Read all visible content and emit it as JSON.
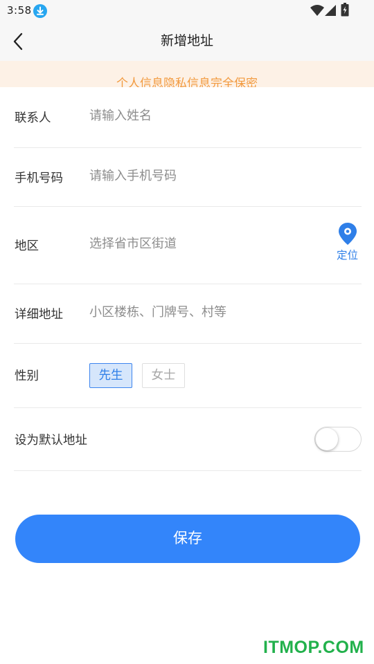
{
  "status_bar": {
    "time": "3:58",
    "icons": [
      "download-icon",
      "wifi-icon",
      "signal-icon",
      "battery-icon"
    ]
  },
  "nav": {
    "title": "新增地址",
    "back_icon": "back-arrow-icon"
  },
  "notice": {
    "text": "个人信息隐私信息完全保密"
  },
  "form": {
    "contact": {
      "label": "联系人",
      "placeholder": "请输入姓名"
    },
    "phone": {
      "label": "手机号码",
      "placeholder": "请输入手机号码"
    },
    "region": {
      "label": "地区",
      "placeholder": "选择省市区街道",
      "locate_label": "定位"
    },
    "detail": {
      "label": "详细地址",
      "placeholder": "小区楼栋、门牌号、村等"
    },
    "gender": {
      "label": "性别",
      "options": [
        "先生",
        "女士"
      ],
      "selected": "先生"
    },
    "default": {
      "label": "设为默认地址",
      "enabled": false
    }
  },
  "save_label": "保存",
  "watermark": "ITMOP.COM",
  "colors": {
    "accent": "#3385fa",
    "notice_text": "#f29a3f",
    "notice_bg": "#fdf1e6",
    "watermark": "#22b14c"
  }
}
